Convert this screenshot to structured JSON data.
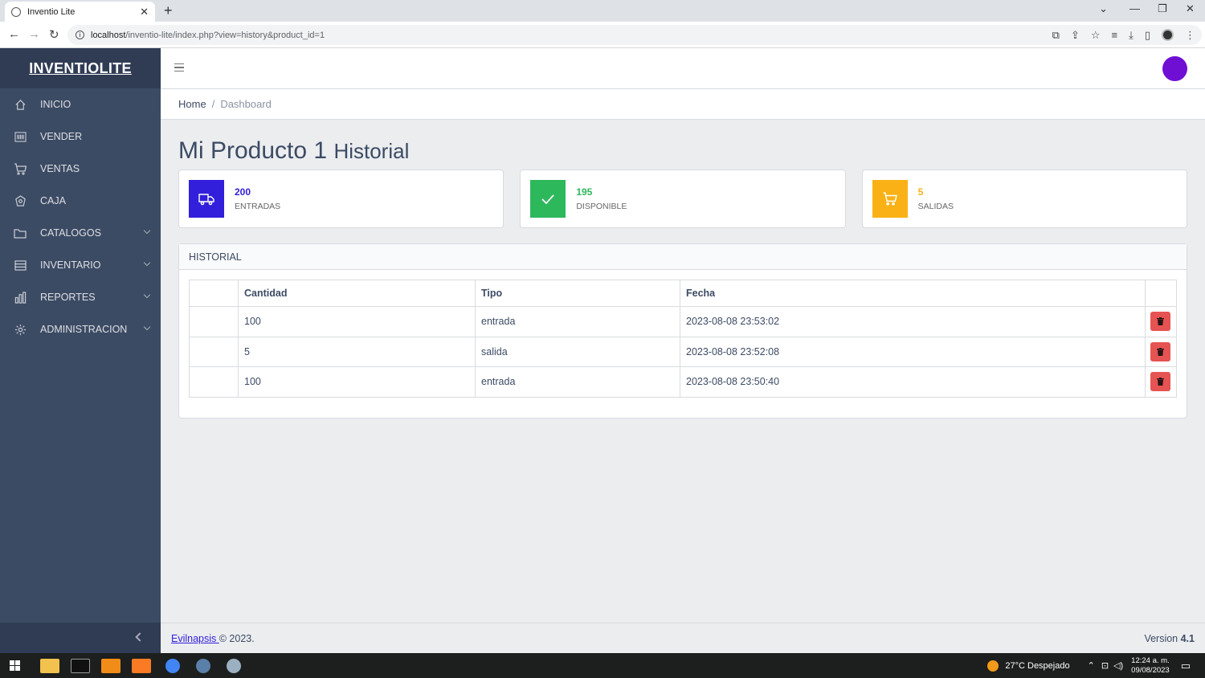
{
  "browser": {
    "tab_title": "Inventio Lite",
    "tab_close": "✕",
    "new_tab": "+",
    "url_host": "localhost",
    "url_path": "/inventio-lite/index.php?view=history&product_id=1"
  },
  "sidebar": {
    "brand": "INVENTIOLITE",
    "items": [
      {
        "label": "INICIO",
        "icon": "home-icon",
        "has_children": false
      },
      {
        "label": "VENDER",
        "icon": "barcode-icon",
        "has_children": false
      },
      {
        "label": "VENTAS",
        "icon": "cart-icon",
        "has_children": false
      },
      {
        "label": "CAJA",
        "icon": "cash-register-icon",
        "has_children": false
      },
      {
        "label": "CATALOGOS",
        "icon": "folder-icon",
        "has_children": true
      },
      {
        "label": "INVENTARIO",
        "icon": "list-icon",
        "has_children": true
      },
      {
        "label": "REPORTES",
        "icon": "chart-icon",
        "has_children": true
      },
      {
        "label": "ADMINISTRACION",
        "icon": "gear-icon",
        "has_children": true
      }
    ]
  },
  "breadcrumb": {
    "home": "Home",
    "separator": "/",
    "active": "Dashboard"
  },
  "page": {
    "title": "Mi Producto 1",
    "subtitle": "Historial"
  },
  "widgets": [
    {
      "value": "200",
      "label": "ENTRADAS",
      "color": "#321fdb",
      "icon": "truck-icon"
    },
    {
      "value": "195",
      "label": "DISPONIBLE",
      "color": "#2eb85c",
      "icon": "check-icon"
    },
    {
      "value": "5",
      "label": "SALIDAS",
      "color": "#f9b115",
      "icon": "cart-icon"
    }
  ],
  "history": {
    "header": "HISTORIAL",
    "columns": [
      "",
      "Cantidad",
      "Tipo",
      "Fecha",
      ""
    ],
    "rows": [
      {
        "cantidad": "100",
        "tipo": "entrada",
        "fecha": "2023-08-08 23:53:02"
      },
      {
        "cantidad": "5",
        "tipo": "salida",
        "fecha": "2023-08-08 23:52:08"
      },
      {
        "cantidad": "100",
        "tipo": "entrada",
        "fecha": "2023-08-08 23:50:40"
      }
    ]
  },
  "footer": {
    "link": "Evilnapsis ",
    "copyright": "© 2023.",
    "version_label": "Version ",
    "version": "4.1"
  },
  "taskbar": {
    "weather": "27°C  Despejado",
    "time": "12:24 a. m.",
    "date": "09/08/2023"
  },
  "colors": {
    "sidebar": "#3c4b64",
    "brand_bg": "#303c54",
    "danger": "#e55353",
    "avatar": "#6f0fd4"
  }
}
